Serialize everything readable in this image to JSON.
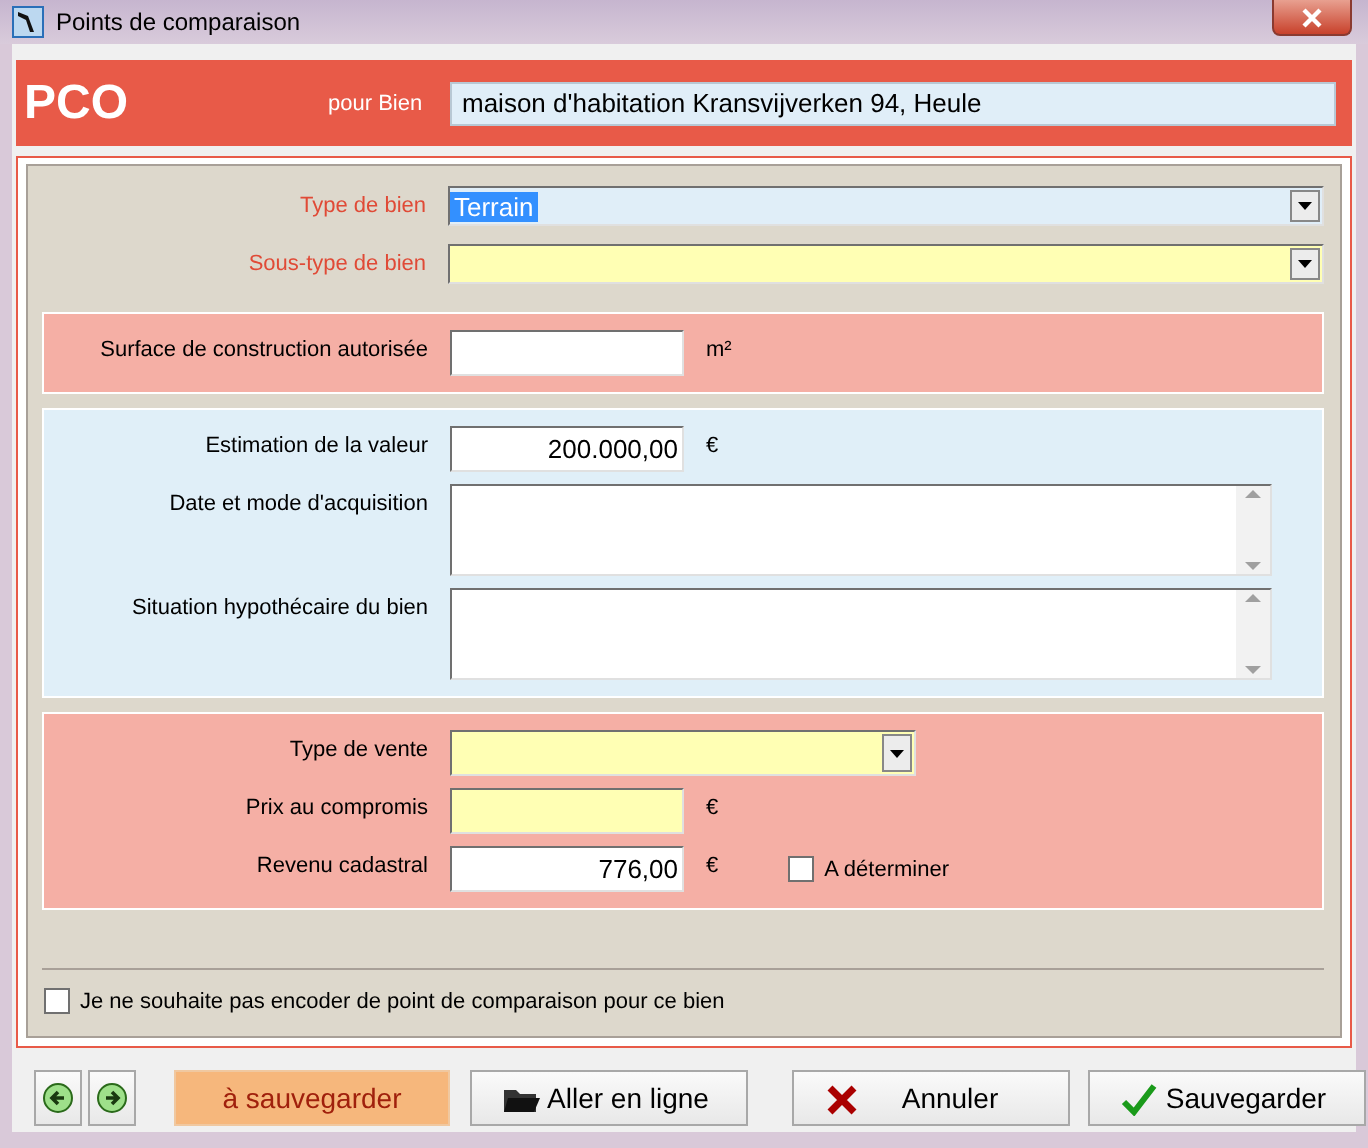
{
  "window": {
    "title": "Points de comparaison"
  },
  "header": {
    "code": "PCO",
    "for_label": "pour Bien",
    "property": "maison d'habitation Kransvijverken 94, Heule"
  },
  "sections": [
    {
      "kind": "plain",
      "fields": [
        {
          "kind": "combo",
          "label": "Type de bien",
          "value": "Terrain",
          "required": true,
          "highlighted": false,
          "focused": true
        },
        {
          "kind": "combo",
          "label": "Sous-type de bien",
          "required": true,
          "highlighted": true,
          "focused": false
        }
      ]
    },
    {
      "kind": "alert",
      "fields": [
        {
          "kind": "amount",
          "label": "Surface de construction autorisée",
          "unit": "m²",
          "required": false,
          "highlighted": false,
          "focused": false
        }
      ]
    },
    {
      "kind": "info",
      "fields": [
        {
          "kind": "amount",
          "label": "Estimation de la valeur",
          "value": "200.000,00",
          "unit": "€",
          "required": false,
          "highlighted": false,
          "focused": false
        },
        {
          "kind": "memo",
          "label": "Date et mode d'acquisition",
          "required": false,
          "highlighted": false,
          "focused": false
        },
        {
          "kind": "memo",
          "label": "Situation hypothécaire du bien",
          "required": false,
          "highlighted": false,
          "focused": false
        }
      ]
    },
    {
      "kind": "alert",
      "fields": [
        {
          "kind": "dropdown",
          "label": "Type de vente",
          "required": false,
          "highlighted": true,
          "focused": false
        },
        {
          "kind": "amount",
          "label": "Prix au compromis",
          "unit": "€",
          "required": false,
          "highlighted": true,
          "focused": false
        },
        {
          "kind": "amount",
          "label": "Revenu cadastral",
          "value": "776,00",
          "unit": "€",
          "required": false,
          "highlighted": false,
          "focused": false,
          "option": {
            "label": "A déterminer",
            "checked": false
          }
        }
      ]
    }
  ],
  "opt_out": {
    "label": "Je ne souhaite pas encoder de point de comparaison pour ce bien",
    "checked": false
  },
  "buttons": [
    {
      "kind": "prev"
    },
    {
      "kind": "next"
    },
    {
      "kind": "status",
      "label": "à sauvegarder"
    },
    {
      "kind": "action",
      "label": "Aller en ligne"
    },
    {
      "kind": "action",
      "label": "Annuler"
    },
    {
      "kind": "action",
      "label": "Sauvegarder"
    }
  ]
}
